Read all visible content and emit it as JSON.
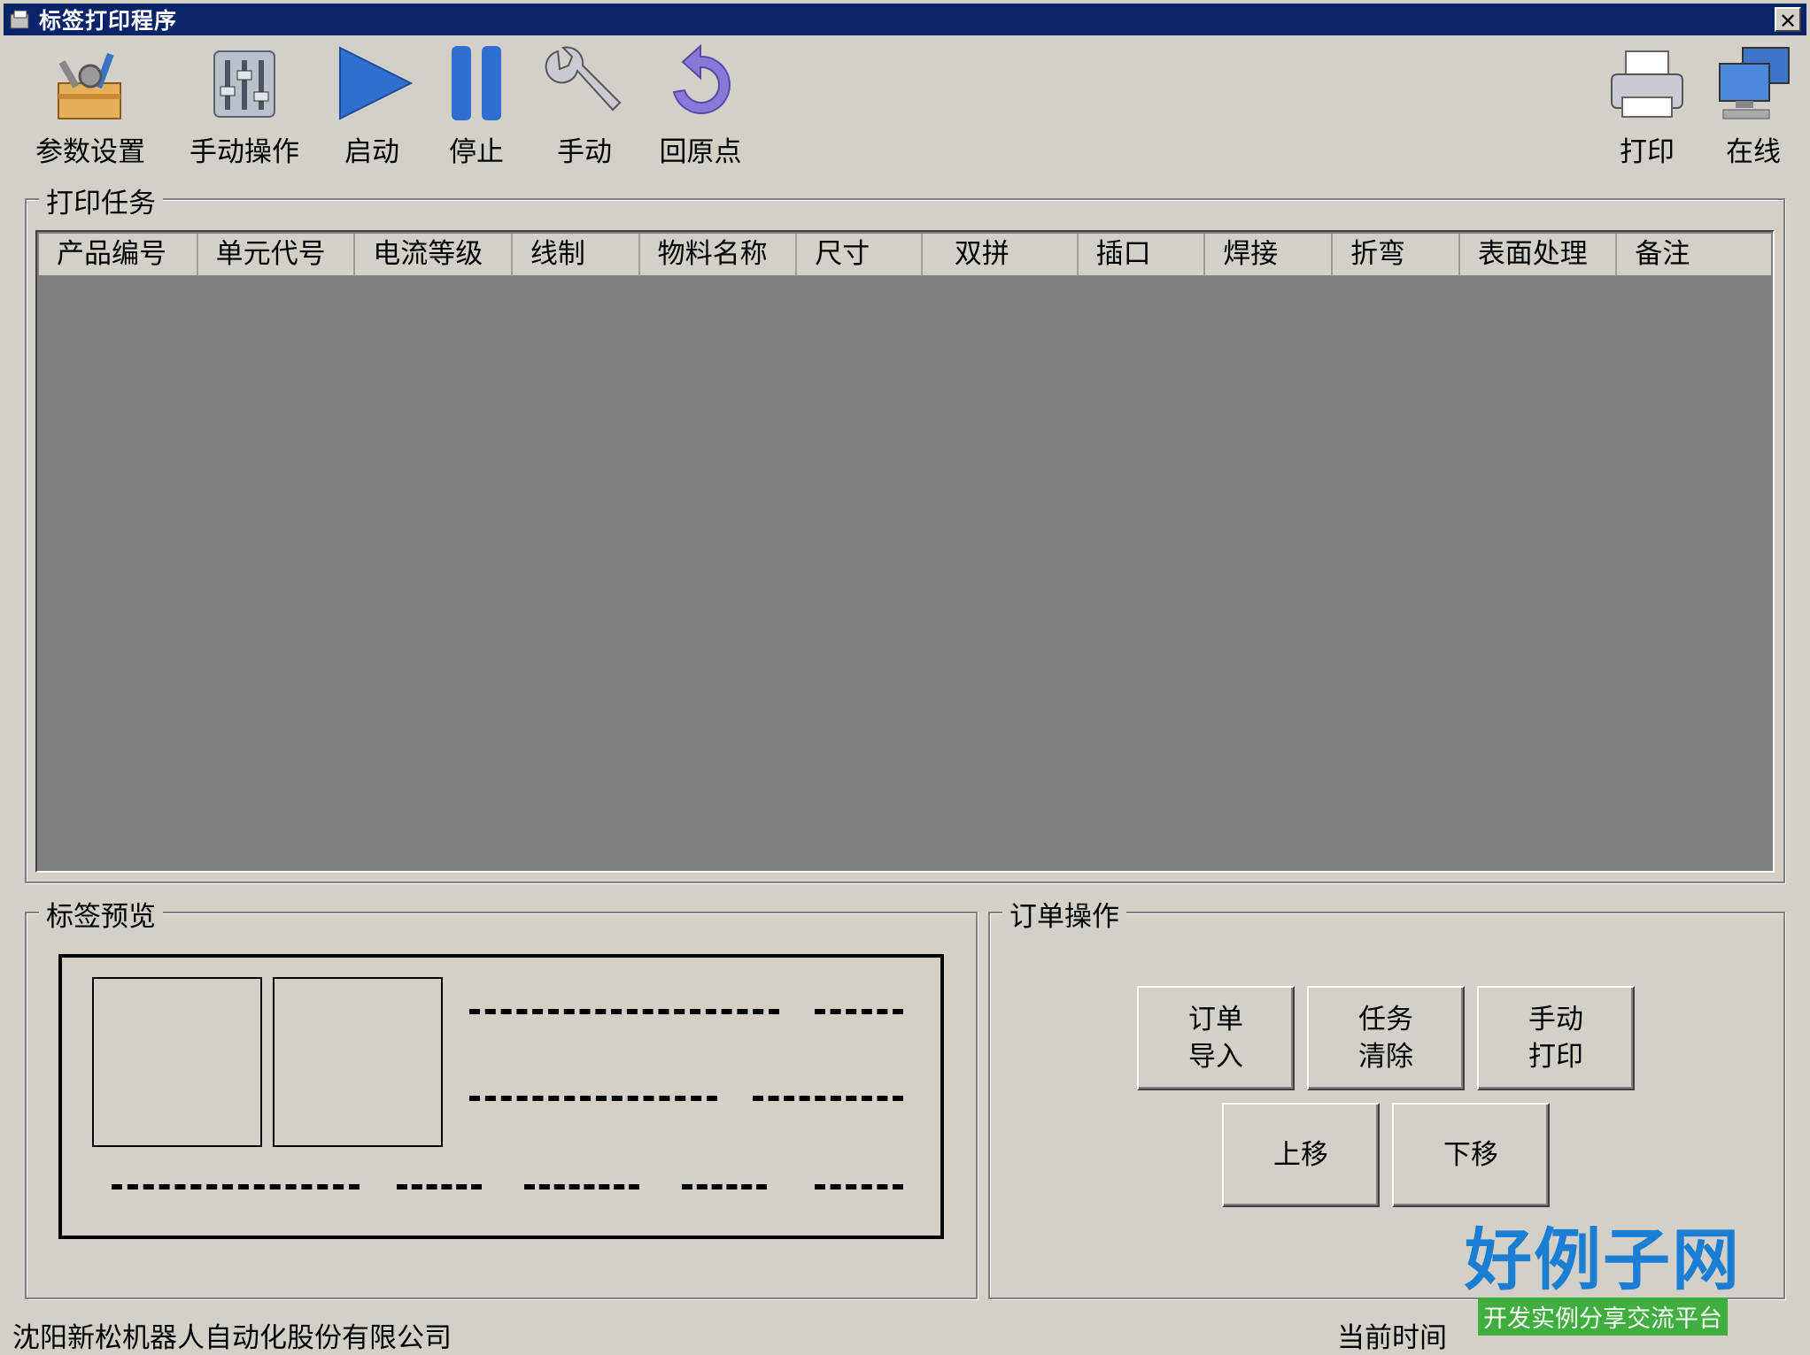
{
  "window": {
    "title": "标签打印程序",
    "close_label": "✕"
  },
  "toolbar": {
    "items": [
      {
        "label": "参数设置",
        "icon": "toolbox-icon"
      },
      {
        "label": "手动操作",
        "icon": "mixer-icon"
      },
      {
        "label": "启动",
        "icon": "play-icon"
      },
      {
        "label": "停止",
        "icon": "pause-icon"
      },
      {
        "label": "手动",
        "icon": "wrench-icon"
      },
      {
        "label": "回原点",
        "icon": "return-origin-icon"
      }
    ],
    "right_items": [
      {
        "label": "打印",
        "icon": "printer-icon"
      },
      {
        "label": "在线",
        "icon": "network-computer-icon"
      }
    ]
  },
  "print_tasks": {
    "legend": "打印任务",
    "columns": [
      "产品编号",
      "单元代号",
      "电流等级",
      "线制",
      "物料名称",
      "尺寸",
      "双拼",
      "插口",
      "焊接",
      "折弯",
      "表面处理",
      "备注"
    ],
    "rows": []
  },
  "label_preview": {
    "legend": "标签预览"
  },
  "order_ops": {
    "legend": "订单操作",
    "buttons": {
      "import_order": "订单\n导入",
      "clear_tasks": "任务\n清除",
      "manual_print": "手动\n打印",
      "move_up": "上移",
      "move_down": "下移"
    }
  },
  "status": {
    "company": "沈阳新松机器人自动化股份有限公司",
    "time_label": "当前时间"
  },
  "watermark": {
    "brand": "好例子网",
    "tagline": "开发实例分享交流平台"
  },
  "colors": {
    "titlebar": "#0a246a",
    "panel": "#d4d0c8",
    "table_bg": "#808080",
    "brand_blue": "#1a7fd4",
    "brand_green": "#3fae3f"
  }
}
